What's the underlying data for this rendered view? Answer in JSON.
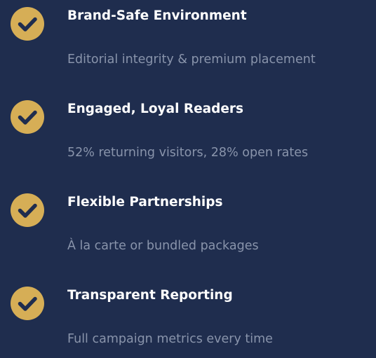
{
  "colors": {
    "background": "#1f2d4e",
    "check_fill": "#d6ae56",
    "check_mark": "#1f2d4e",
    "title": "#ffffff",
    "description": "#8994ab"
  },
  "features": [
    {
      "icon": "check-circle-icon",
      "title": "Brand-Safe Environment",
      "description": "Editorial integrity & premium placement"
    },
    {
      "icon": "check-circle-icon",
      "title": "Engaged, Loyal Readers",
      "description": "52% returning visitors, 28% open rates"
    },
    {
      "icon": "check-circle-icon",
      "title": "Flexible Partnerships",
      "description": "À la carte or bundled packages"
    },
    {
      "icon": "check-circle-icon",
      "title": "Transparent Reporting",
      "description": "Full campaign metrics every time"
    }
  ]
}
